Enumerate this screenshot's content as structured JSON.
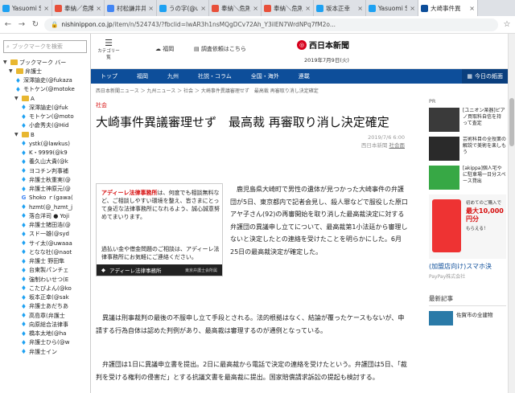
{
  "tabs": [
    {
      "title": "Yasuomi S",
      "icon_color": "#1da1f2",
      "active": false
    },
    {
      "title": "奉納／危険",
      "icon_color": "#e8503a",
      "active": false
    },
    {
      "title": "村松謙井井",
      "icon_color": "#4285f4",
      "active": false
    },
    {
      "title": "うの字(@u",
      "icon_color": "#1da1f2",
      "active": false
    },
    {
      "title": "奉納＼危則",
      "icon_color": "#e8503a",
      "active": false
    },
    {
      "title": "奉納＼危則",
      "icon_color": "#e8503a",
      "active": false
    },
    {
      "title": "坂本正幸",
      "icon_color": "#1da1f2",
      "active": false
    },
    {
      "title": "Yasuomi S",
      "icon_color": "#1da1f2",
      "active": false
    },
    {
      "title": "大崎事件異",
      "icon_color": "#0d4e9a",
      "active": true
    }
  ],
  "address": {
    "host": "nishinippon.co.jp",
    "path": "/item/n/524743/?fbclid=IwAR3h1nsMQgDCv72Ah_Y3ilEN7WrdNPq7fM2o..."
  },
  "sidebar": {
    "search_placeholder": "ブックマークを検索",
    "rows": [
      {
        "label": "ブックマーク バー",
        "kind": "folder",
        "indent": 0,
        "arrow": "▼"
      },
      {
        "label": "弁護士",
        "kind": "folder",
        "indent": 1,
        "arrow": "▼"
      },
      {
        "label": "深澤諭史(@fukaza",
        "kind": "twitter",
        "indent": 2
      },
      {
        "label": "モトケン(@motoke",
        "kind": "twitter",
        "indent": 2
      },
      {
        "label": "A",
        "kind": "folder",
        "indent": 2,
        "arrow": "▼"
      },
      {
        "label": "深澤諭史(@fuk",
        "kind": "twitter",
        "indent": 3
      },
      {
        "label": "モトケン(@moto",
        "kind": "twitter",
        "indent": 3
      },
      {
        "label": "小倉秀夫(@Hid",
        "kind": "twitter",
        "indent": 3
      },
      {
        "label": "B",
        "kind": "folder",
        "indent": 2,
        "arrow": "▼"
      },
      {
        "label": "ystk(@lawkus)",
        "kind": "twitter",
        "indent": 3
      },
      {
        "label": "K・9999(@k9",
        "kind": "twitter",
        "indent": 3
      },
      {
        "label": "養久山大貴(@k",
        "kind": "twitter",
        "indent": 3
      },
      {
        "label": "ヨコチン判事補",
        "kind": "twitter",
        "indent": 3
      },
      {
        "label": "弁護士秋重実(@",
        "kind": "twitter",
        "indent": 3
      },
      {
        "label": "弁護士神原元(@",
        "kind": "twitter",
        "indent": 3
      },
      {
        "label": "Shoko ｒ(gawa(",
        "kind": "google",
        "indent": 3
      },
      {
        "label": "hzmt(@_hzmt_j",
        "kind": "twitter",
        "indent": 3
      },
      {
        "label": "落合洋司 ● Yoji",
        "kind": "twitter",
        "indent": 3
      },
      {
        "label": "弁護士猪田浩(@",
        "kind": "twitter",
        "indent": 3
      },
      {
        "label": "スド一雄(@syd",
        "kind": "twitter",
        "indent": 3
      },
      {
        "label": "サイ太(@uwaaa",
        "kind": "twitter",
        "indent": 3
      },
      {
        "label": "となな社(@naot",
        "kind": "twitter",
        "indent": 3
      },
      {
        "label": "弁護士 野田隼",
        "kind": "twitter",
        "indent": 3
      },
      {
        "label": "台東製パンチェ",
        "kind": "twitter",
        "indent": 3
      },
      {
        "label": "強制わいせつ(E",
        "kind": "twitter",
        "indent": 3
      },
      {
        "label": "こたぴよん(@ko",
        "kind": "twitter",
        "indent": 3
      },
      {
        "label": "坂本正幸(@sak",
        "kind": "twitter",
        "indent": 3
      },
      {
        "label": "弁護士あだちあ",
        "kind": "twitter",
        "indent": 3
      },
      {
        "label": "高島章(弁護士",
        "kind": "twitter",
        "indent": 3
      },
      {
        "label": "向原総合法律事",
        "kind": "twitter",
        "indent": 3
      },
      {
        "label": "橋本太地(@ha",
        "kind": "twitter",
        "indent": 3
      },
      {
        "label": "弁護士ひら(@w",
        "kind": "twitter",
        "indent": 3
      },
      {
        "label": "弁護士イン",
        "kind": "twitter",
        "indent": 3
      }
    ]
  },
  "site": {
    "category_label": "カテゴリー覧",
    "weather": "福岡",
    "request_link": "調査依頼はこちら",
    "logo": "西日本新聞",
    "date": "2019年7月9日(火)",
    "nav": [
      "トップ",
      "福岡",
      "九州",
      "社説・コラム",
      "全国・海外",
      "連載"
    ],
    "nav_today": "今日の紙面",
    "breadcrumb": "西日本新聞ニュース ＞ 九州ニュース ＞ 社会 ＞ 大崎事件異議審理せず　最高裁 再審取り消し決定確定"
  },
  "article": {
    "section": "社会",
    "headline": "大崎事件異議審理せず　最高裁 再審取り消し決定確定",
    "timestamp": "2019/7/6 6:00",
    "author": "西日本新聞",
    "author_link": "社会面",
    "para1": "鹿児島県大崎町で男性の遺体が見つかった大崎事件の弁護団が5日、東京都内で記者会見し、殺人罪などで服役した原口アヤ子さん(92)の再審開始を取り消した最高裁決定に対する弁護団の異議申し立てについて、最高裁第1小法廷から審理しないと決定したとの連絡を受けたことを明らかにした。6月25日の最高裁決定が確定した。",
    "para2": "異議は刑事裁判の最後の不服申し立て手段とされる。法的根拠はなく、結論が覆ったケースもないが、申請する行為自体は認めた判例があり、最高裁は審理するのが通例となっている。",
    "para3": "弁護団は1日に異議申立書を提出。2日に最高裁から電話で決定の連絡を受けたという。弁護団は5日、「裁判を受ける権利の侵害だ」とする抗議文書を最高裁に提出。国家賠償請求訴訟の提起も検討する。"
  },
  "ad": {
    "name": "アディーレ法律事務所",
    "top_text": "は、何度でも相談無料など、ご相談しやすい環境を整え、皆さまにとって身近な法律事務所になれるよう、誠心誠意努めてまいります。",
    "mid_text": "過払い金や借金問題のご相談は、アディーレ法律事務所にお気軽にご連絡ください。",
    "bar": "アディーレ法律事務所",
    "bar_small": "東京弁護士会所属"
  },
  "right": {
    "pr": "PR",
    "items": [
      {
        "text": "[ユニオン楽器]ピアノ買取料自信を持って査定"
      },
      {
        "text": "芸術科目の全授業の解説で美術を楽しもう"
      },
      {
        "text": "[akippa]個人宅やに駐車場一日分スペース貸出"
      }
    ],
    "bigad_pre": "初めてのご購入で",
    "bigad_offer": "最大10,000円分",
    "bigad_post": "もらえる！",
    "bigad_title": "(加盟店向け)スマホ決",
    "bigad_sub": "PayPay株式会社",
    "latest": "最新記事",
    "latest_item": "佐賀市の全建物"
  }
}
